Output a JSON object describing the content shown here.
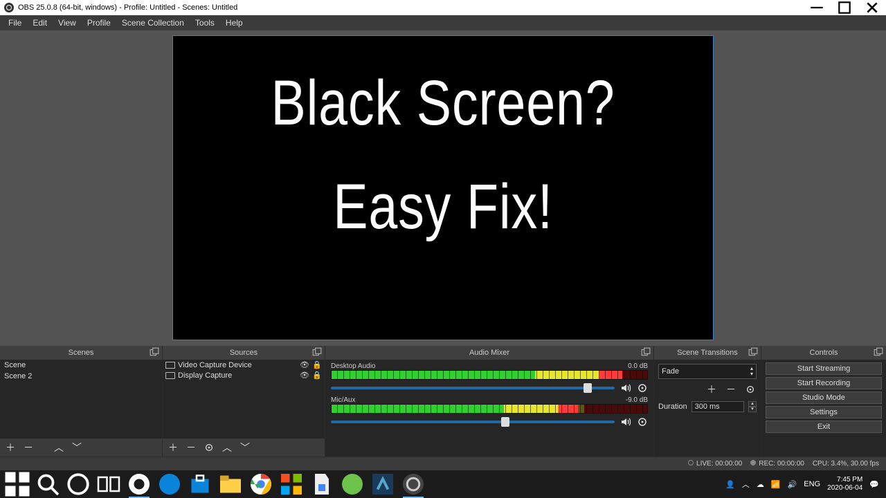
{
  "window": {
    "title": "OBS 25.0.8 (64-bit, windows) - Profile: Untitled - Scenes: Untitled"
  },
  "menus": [
    "File",
    "Edit",
    "View",
    "Profile",
    "Scene Collection",
    "Tools",
    "Help"
  ],
  "preview": {
    "line1": "Black Screen?",
    "line2": "Easy Fix!"
  },
  "panels": {
    "scenes_title": "Scenes",
    "sources_title": "Sources",
    "mixer_title": "Audio Mixer",
    "transitions_title": "Scene Transitions",
    "controls_title": "Controls"
  },
  "scenes": [
    "Scene",
    "Scene 2"
  ],
  "sources": [
    {
      "label": "Video Capture Device"
    },
    {
      "label": "Display Capture"
    }
  ],
  "mixer": {
    "tracks": [
      {
        "name": "Desktop Audio",
        "db": "0.0 dB",
        "fill": 92,
        "thumb": 89
      },
      {
        "name": "Mic/Aux",
        "db": "-9.0 dB",
        "fill": 78,
        "thumb": 60
      }
    ]
  },
  "transitions": {
    "selected": "Fade",
    "duration_label": "Duration",
    "duration_value": "300 ms"
  },
  "controls": [
    "Start Streaming",
    "Start Recording",
    "Studio Mode",
    "Settings",
    "Exit"
  ],
  "status": {
    "live": "LIVE: 00:00:00",
    "rec": "REC: 00:00:00",
    "cpu": "CPU: 3.4%, 30.00 fps"
  },
  "taskbar": {
    "lang": "ENG",
    "time": "7:45 PM",
    "date": "2020-06-04"
  }
}
